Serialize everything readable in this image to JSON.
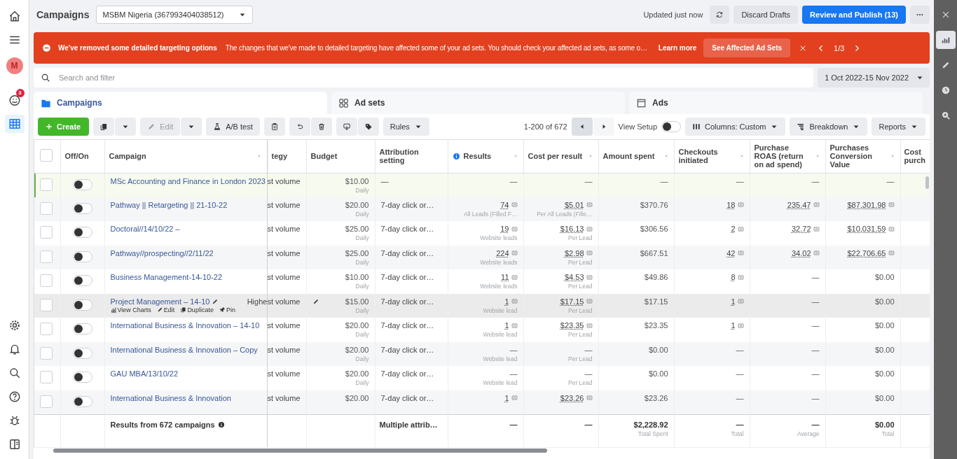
{
  "left_rail": {
    "top": [
      {
        "kind": "home",
        "selected": false
      },
      {
        "kind": "menu",
        "selected": false
      },
      {
        "kind": "avatar",
        "text": "M",
        "selected": false
      },
      {
        "kind": "alerts",
        "badge": "3",
        "selected": false
      },
      {
        "kind": "table",
        "selected": true
      }
    ],
    "bottom": [
      {
        "kind": "settings",
        "selected": false
      },
      {
        "kind": "bell",
        "selected": false
      },
      {
        "kind": "search",
        "selected": false
      },
      {
        "kind": "help",
        "selected": false
      },
      {
        "kind": "bug",
        "selected": false
      },
      {
        "kind": "panel",
        "selected": false
      }
    ]
  },
  "right_rail": [
    {
      "kind": "close",
      "selected": false
    },
    {
      "kind": "chart",
      "selected": true
    },
    {
      "kind": "pencil",
      "selected": false
    },
    {
      "kind": "clock",
      "selected": false
    },
    {
      "kind": "zoom",
      "selected": false
    }
  ],
  "header": {
    "title": "Campaigns",
    "account": "MSBM Nigeria (367993404038512)",
    "status": "Updated just now",
    "buttons": [
      {
        "label": "Discard Drafts",
        "kind": "secondary"
      },
      {
        "label": "Review and Publish (13)",
        "kind": "primary"
      }
    ]
  },
  "banner": {
    "title": "We've removed some detailed targeting options",
    "message": "The changes that we've made to detailed targeting have affected some of your ad sets. You should check your affected ad sets, as some o…",
    "link": "Learn more",
    "button": "See Affected Ad Sets",
    "pager": "1/3"
  },
  "search": {
    "placeholder": "Search and filter",
    "date_range": "1 Oct 2022-15 Nov 2022"
  },
  "tabs": [
    {
      "label": "Campaigns",
      "kind": "campaigns",
      "selected": true
    },
    {
      "label": "Ad sets",
      "kind": "adsets",
      "selected": false
    },
    {
      "label": "Ads",
      "kind": "ads",
      "selected": false
    }
  ],
  "toolbar": {
    "create": "Create",
    "edit": {
      "label": "Edit",
      "disabled": true
    },
    "ab_test": "A/B test",
    "rules": "Rules",
    "range": "1-200 of 672",
    "view_setup": {
      "label": "View Setup",
      "on": false
    },
    "columns": "Columns: Custom",
    "breakdown": "Breakdown",
    "reports": "Reports"
  },
  "table": {
    "select_all": false,
    "columns": [
      {
        "label": "Off/On",
        "sortable": false
      },
      {
        "label": "Campaign",
        "sortable": true
      },
      {
        "label": "tegy",
        "sortable": false
      },
      {
        "label": "Budget",
        "sortable": false
      },
      {
        "label": "Attribution setting",
        "sortable": false
      },
      {
        "label": "Results",
        "sortable": true,
        "info": true
      },
      {
        "label": "Cost per result",
        "sortable": true
      },
      {
        "label": "Amount spent",
        "sortable": true
      },
      {
        "label": "Checkouts initiated",
        "sortable": true
      },
      {
        "label": "Purchase ROAS (return on ad spend)",
        "sortable": true
      },
      {
        "label": "Purchases Conversion Value",
        "sortable": true
      },
      {
        "label": "Cost purch",
        "sortable": false
      }
    ],
    "rows": [
      {
        "checked": false,
        "on": false,
        "highlighted": true,
        "hovered": false,
        "campaign": "MSc Accounting and Finance in London 2023",
        "strategy": "st volume",
        "budget": {
          "value": "$10.00",
          "sub": "Daily"
        },
        "attribution": "—",
        "results": {
          "value": "—",
          "linked": false
        },
        "cost": {
          "value": "—",
          "linked": false
        },
        "spent": {
          "value": "—",
          "linked": false
        },
        "checkouts": {
          "value": "—",
          "linked": false
        },
        "roas": {
          "value": "—",
          "linked": false
        },
        "conv": {
          "value": "—",
          "linked": false
        }
      },
      {
        "checked": false,
        "on": false,
        "highlighted": false,
        "hovered": false,
        "campaign": "Pathway || Retargeting || 21-10-22",
        "strategy": "st volume",
        "budget": {
          "value": "$20.00",
          "sub": "Daily"
        },
        "attribution": "7-day click or…",
        "results": {
          "value": "74",
          "linked": true,
          "sub": "All Leads (Filled F…"
        },
        "cost": {
          "value": "$5.01",
          "linked": true,
          "sub": "Per All Leads (Fille…"
        },
        "spent": {
          "value": "$370.76",
          "linked": false
        },
        "checkouts": {
          "value": "18",
          "linked": true
        },
        "roas": {
          "value": "235.47",
          "linked": true
        },
        "conv": {
          "value": "$87,301.98",
          "linked": true
        }
      },
      {
        "checked": false,
        "on": false,
        "highlighted": false,
        "hovered": false,
        "campaign": "Doctoral//14/10/22 –",
        "strategy": "st volume",
        "budget": {
          "value": "$25.00",
          "sub": "Daily"
        },
        "attribution": "7-day click or…",
        "results": {
          "value": "19",
          "linked": true,
          "sub": "Website leads"
        },
        "cost": {
          "value": "$16.13",
          "linked": true,
          "sub": "Per Lead"
        },
        "spent": {
          "value": "$306.56",
          "linked": false
        },
        "checkouts": {
          "value": "2",
          "linked": true
        },
        "roas": {
          "value": "32.72",
          "linked": true
        },
        "conv": {
          "value": "$10,031.59",
          "linked": true
        }
      },
      {
        "checked": false,
        "on": false,
        "highlighted": false,
        "hovered": false,
        "campaign": "Pathway//prospecting//2/11/22",
        "strategy": "st volume",
        "budget": {
          "value": "$25.00",
          "sub": "Daily"
        },
        "attribution": "7-day click or…",
        "results": {
          "value": "224",
          "linked": true,
          "sub": "Website leads"
        },
        "cost": {
          "value": "$2.98",
          "linked": true,
          "sub": "Per Lead"
        },
        "spent": {
          "value": "$667.51",
          "linked": false
        },
        "checkouts": {
          "value": "42",
          "linked": true
        },
        "roas": {
          "value": "34.02",
          "linked": true
        },
        "conv": {
          "value": "$22,706.65",
          "linked": true
        }
      },
      {
        "checked": false,
        "on": false,
        "highlighted": false,
        "hovered": false,
        "campaign": "Business Management-14-10-22",
        "strategy": "st volume",
        "budget": {
          "value": "$10.00",
          "sub": "Daily"
        },
        "attribution": "7-day click or…",
        "results": {
          "value": "11",
          "linked": true,
          "sub": "Website leads"
        },
        "cost": {
          "value": "$4.53",
          "linked": true,
          "sub": "Per Lead"
        },
        "spent": {
          "value": "$49.86",
          "linked": false
        },
        "checkouts": {
          "value": "8",
          "linked": true
        },
        "roas": {
          "value": "—",
          "linked": false
        },
        "conv": {
          "value": "$0.00",
          "linked": false
        }
      },
      {
        "checked": false,
        "on": false,
        "highlighted": false,
        "hovered": true,
        "campaign": "Project Management – 14-10",
        "actions": [
          "View Charts",
          "Edit",
          "Duplicate",
          "Pin"
        ],
        "strategy": "Highest volume",
        "budget": {
          "value": "$15.00",
          "sub": "Daily"
        },
        "attribution": "7-day click or…",
        "results": {
          "value": "1",
          "linked": true,
          "sub": "Website lead"
        },
        "cost": {
          "value": "$17.15",
          "linked": true,
          "sub": "Per Lead"
        },
        "spent": {
          "value": "$17.15",
          "linked": false
        },
        "checkouts": {
          "value": "1",
          "linked": true
        },
        "roas": {
          "value": "—",
          "linked": false
        },
        "conv": {
          "value": "$0.00",
          "linked": false
        }
      },
      {
        "checked": false,
        "on": false,
        "highlighted": false,
        "hovered": false,
        "campaign": "International Business & Innovation – 14-10",
        "strategy": "st volume",
        "budget": {
          "value": "$20.00",
          "sub": "Daily"
        },
        "attribution": "7-day click or…",
        "results": {
          "value": "1",
          "linked": true,
          "sub": "Website lead"
        },
        "cost": {
          "value": "$23.35",
          "linked": true,
          "sub": "Per Lead"
        },
        "spent": {
          "value": "$23.35",
          "linked": false
        },
        "checkouts": {
          "value": "1",
          "linked": true
        },
        "roas": {
          "value": "—",
          "linked": false
        },
        "conv": {
          "value": "$0.00",
          "linked": false
        }
      },
      {
        "checked": false,
        "on": false,
        "highlighted": false,
        "hovered": false,
        "campaign": "International Business & Innovation – Copy",
        "strategy": "st volume",
        "budget": {
          "value": "$20.00",
          "sub": "Daily"
        },
        "attribution": "7-day click or…",
        "results": {
          "value": "—",
          "linked": false,
          "sub": "Website lead"
        },
        "cost": {
          "value": "—",
          "linked": false,
          "sub": "Per Lead"
        },
        "spent": {
          "value": "$0.00",
          "linked": false
        },
        "checkouts": {
          "value": "—",
          "linked": false
        },
        "roas": {
          "value": "—",
          "linked": false
        },
        "conv": {
          "value": "$0.00",
          "linked": false
        }
      },
      {
        "checked": false,
        "on": false,
        "highlighted": false,
        "hovered": false,
        "campaign": "GAU MBA/13/10/22",
        "strategy": "st volume",
        "budget": {
          "value": "$20.00",
          "sub": "Daily"
        },
        "attribution": "7-day click or…",
        "results": {
          "value": "—",
          "linked": false,
          "sub": "Website lead"
        },
        "cost": {
          "value": "—",
          "linked": false,
          "sub": "Per Lead"
        },
        "spent": {
          "value": "$0.00",
          "linked": false
        },
        "checkouts": {
          "value": "—",
          "linked": false
        },
        "roas": {
          "value": "—",
          "linked": false
        },
        "conv": {
          "value": "$0.00",
          "linked": false
        }
      },
      {
        "checked": false,
        "on": false,
        "highlighted": false,
        "hovered": false,
        "campaign": "International Business & Innovation",
        "strategy": "st volume",
        "budget": {
          "value": "$20.00"
        },
        "attribution": "7-day click or…",
        "results": {
          "value": "1",
          "linked": true
        },
        "cost": {
          "value": "$23.26",
          "linked": true
        },
        "spent": {
          "value": "$23.26",
          "linked": false
        },
        "checkouts": {
          "value": "—",
          "linked": false
        },
        "roas": {
          "value": "—",
          "linked": false
        },
        "conv": {
          "value": "$0.00",
          "linked": false
        }
      }
    ],
    "footer": {
      "label": "Results from 672 campaigns",
      "attribution": "Multiple attrib…",
      "results": {
        "value": "—"
      },
      "cost": {
        "value": "—"
      },
      "spent": {
        "value": "$2,228.92",
        "sub": "Total Spent"
      },
      "checkouts": {
        "value": "—",
        "sub": "Total"
      },
      "roas": {
        "value": "—",
        "sub": "Average"
      },
      "conv": {
        "value": "$0.00",
        "sub": "Total"
      }
    }
  }
}
